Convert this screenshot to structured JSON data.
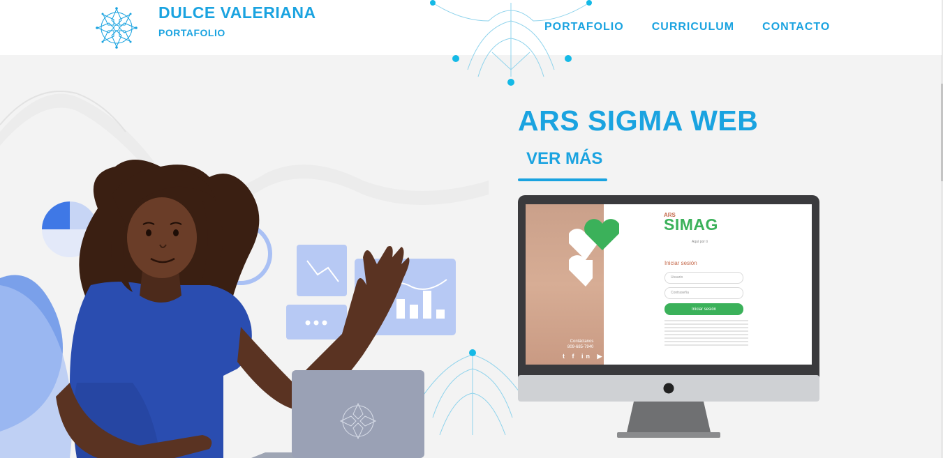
{
  "header": {
    "brand_name": "DULCE VALERIANA",
    "brand_subtitle": "PORTAFOLIO",
    "nav": [
      {
        "label": "PORTAFOLIO"
      },
      {
        "label": "CURRICULUM"
      },
      {
        "label": "CONTACTO"
      }
    ]
  },
  "hero": {
    "project_title": "ARS SIGMA WEB",
    "cta_label": "VER MÁS"
  },
  "mockup": {
    "brand_prefix": "ARS",
    "brand": "SIMAG",
    "tagline": "Aquí por ti",
    "login_title": "Iniciar sesión",
    "username_placeholder": "Usuario",
    "password_placeholder": "Contraseña",
    "login_button": "Iniciar sesión",
    "contact_label": "Contáctanos",
    "phone": "809-685-7940",
    "social": "t f in ▶"
  },
  "colors": {
    "accent": "#1aa3e0",
    "brand_green": "#3bb15a",
    "background": "#f3f3f3"
  }
}
